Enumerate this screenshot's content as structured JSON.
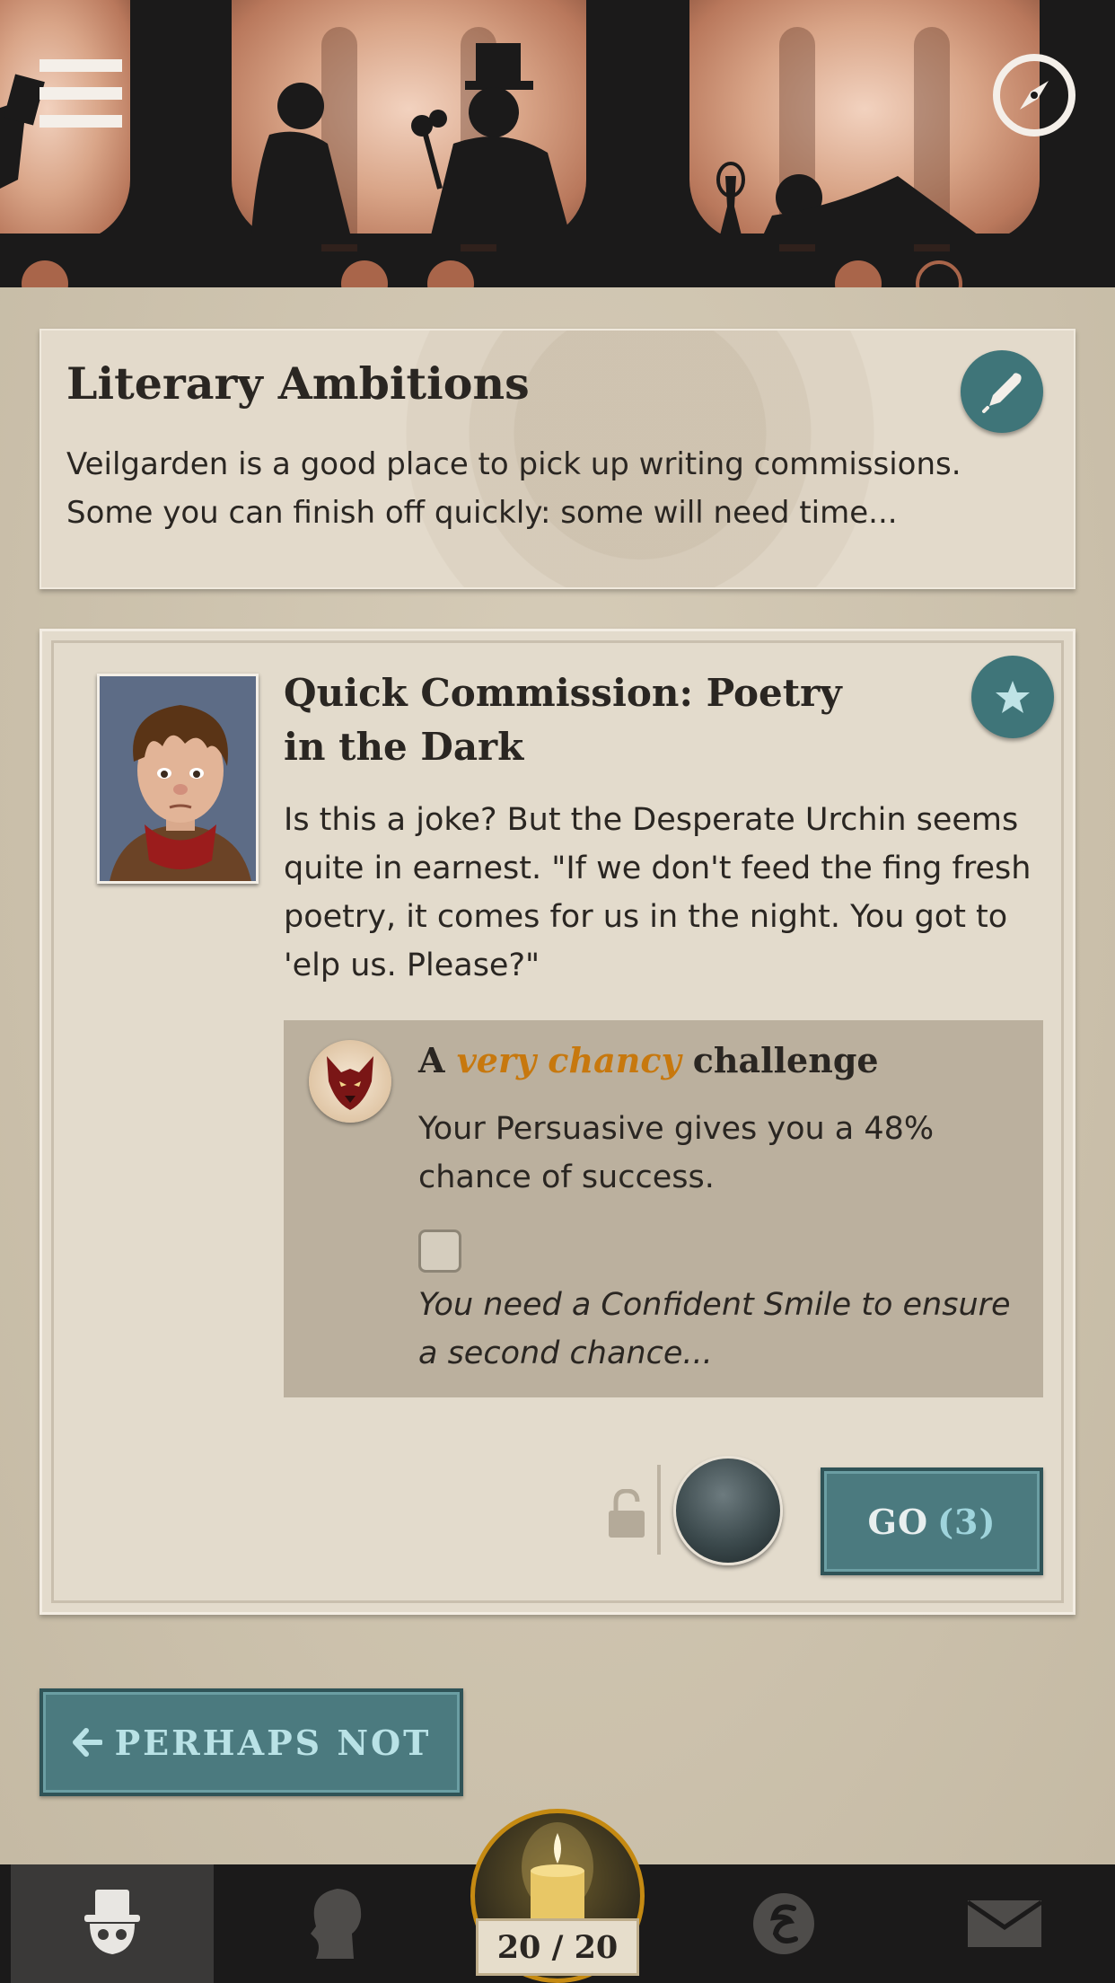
{
  "header": {
    "menu_icon": "hamburger-menu-icon",
    "compass_icon": "compass-icon"
  },
  "storylet": {
    "title": "Literary Ambitions",
    "description": "Veilgarden is a good place to pick up writing commissions. Some you can finish off quickly: some will need time...",
    "action_icon": "quill-icon"
  },
  "branch": {
    "title": "Quick Commission: Poetry in the Dark",
    "description": "Is this a joke? But the Desperate Urchin seems quite in earnest. \"If we don't feed the fing fresh poetry, it comes for us in the night. You got to 'elp us. Please?\"",
    "favourite_icon": "star-icon",
    "challenge": {
      "prefix": "A",
      "difficulty": "very chancy",
      "suffix": "challenge",
      "description": "Your Persuasive gives you a 48% chance of success.",
      "second_chance": "You need a Confident Smile to ensure a second chance...",
      "checked": false
    },
    "go_label": "GO",
    "go_count": "(3)"
  },
  "perhaps_not_label": "PERHAPS NOT",
  "actions": {
    "current": 20,
    "max": 20,
    "label": "20 / 20"
  },
  "nav": {
    "tabs": [
      {
        "name": "story",
        "icon": "top-hat-skull-icon",
        "active": true
      },
      {
        "name": "myself",
        "icon": "profile-head-icon",
        "active": false
      },
      {
        "name": "fate",
        "icon": "fate-icon",
        "active": false
      },
      {
        "name": "messages",
        "icon": "envelope-icon",
        "active": false
      }
    ]
  },
  "colors": {
    "teal": "#4b7a7f",
    "accent_orange": "#c7780e",
    "background": "#c9bea9"
  }
}
